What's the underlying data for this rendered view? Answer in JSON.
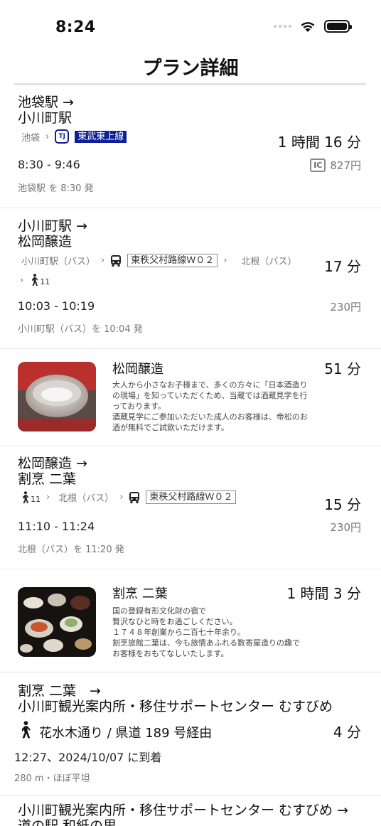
{
  "status": {
    "time": "8:24"
  },
  "nav": {
    "title": "プラン詳細"
  },
  "leg1": {
    "title": "池袋駅 →",
    "title2": "小川町駅",
    "from_station": "池袋",
    "operator_code": "TJ",
    "line": "東武東上線",
    "duration": "1 時間 16 分",
    "time_range": "8:30 - 9:46",
    "fare_badge": "IC",
    "fare": "827円",
    "depart": "池袋駅 を 8:30 発"
  },
  "leg2": {
    "title": "小川町駅 →",
    "title2": "松岡醸造",
    "from_stop": "小川町駅（バス）",
    "line": "東秩父村路線Ｗ０２",
    "to_stop": "北根（バス）",
    "walk_minutes": "11",
    "duration": "17 分",
    "time_range": "10:03 - 10:19",
    "fare": "230円",
    "depart": "小川町駅（バス）を 10:04 発"
  },
  "spot1": {
    "name": "松岡醸造",
    "duration": "51 分",
    "description": "大人から小さなお子様まで、多くの方々に「日本酒造りの現場」を知っていただくため、当蔵では酒蔵見学を行っております。\n酒蔵見学にご参加いただいた成人のお客様は、帝松のお酒が無料でご試飲いただけます。"
  },
  "leg3": {
    "title": "松岡醸造 →",
    "title2": "割烹 二葉",
    "walk_minutes": "11",
    "from_stop": "北根（バス）",
    "line": "東秩父村路線Ｗ０２",
    "duration": "15 分",
    "time_range": "11:10 - 11:24",
    "fare": "230円",
    "depart": "北根（バス）を 11:20 発"
  },
  "spot2": {
    "name": "割烹 二葉",
    "duration": "1 時間 3 分",
    "description": "国の登録有形文化財の宿で\n贅沢なひと時をお過ごしください。\n１７４８年創業から二百七十年余り。\n割烹旅館二葉は、今も旅情あふれる数寄屋造りの趣で\nお客様をおもてなしいたします。"
  },
  "leg4": {
    "title": "割烹 二葉　→",
    "title2": "小川町観光案内所・移住サポートセンター むすびめ",
    "route": "花水木通り / 県道 189 号経由",
    "duration": "4 分",
    "arrive": "12:27、2024/10/07 に到着",
    "meta": "280 m・ほぼ平坦"
  },
  "leg5": {
    "title": "小川町観光案内所・移住サポートセンター むすびめ →",
    "title2": "道の駅 和紙の里"
  },
  "colors": {
    "accent": "#0e1f9a"
  }
}
